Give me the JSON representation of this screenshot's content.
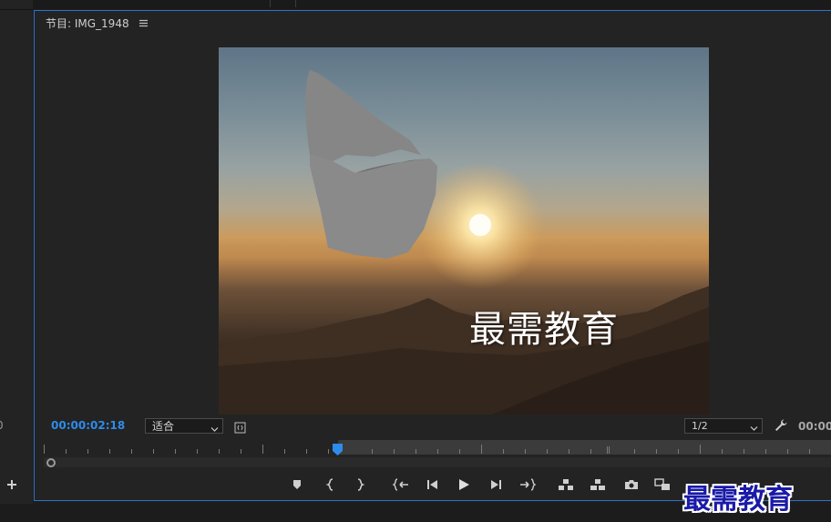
{
  "monitor": {
    "tab_label": "节目: IMG_1948",
    "menu_icon": "hamburger-icon"
  },
  "video": {
    "overlay_title": "最需教育"
  },
  "controls": {
    "timecode_current": "00:00:02:18",
    "fit_value": "适合",
    "resolution_value": "1/2",
    "timecode_right": "00:00",
    "wrench_icon": "wrench-icon"
  },
  "left_panel": {
    "edge_digit": "0",
    "add_icon": "plus-icon"
  },
  "transport": {
    "buttons": [
      {
        "name": "add-marker-button",
        "icon": "marker-icon"
      },
      {
        "name": "mark-in-button",
        "icon": "mark-in-icon"
      },
      {
        "name": "mark-out-button",
        "icon": "mark-out-icon"
      },
      {
        "name": "go-to-in-button",
        "icon": "go-to-in-icon"
      },
      {
        "name": "step-back-button",
        "icon": "step-back-icon"
      },
      {
        "name": "play-button",
        "icon": "play-icon"
      },
      {
        "name": "step-forward-button",
        "icon": "step-forward-icon"
      },
      {
        "name": "go-to-out-button",
        "icon": "go-to-out-icon"
      },
      {
        "name": "lift-button",
        "icon": "lift-icon"
      },
      {
        "name": "extract-button",
        "icon": "extract-icon"
      },
      {
        "name": "export-frame-button",
        "icon": "camera-icon"
      },
      {
        "name": "compare-view-button",
        "icon": "compare-icon"
      }
    ]
  },
  "watermark": {
    "text": "最需教育"
  },
  "colors": {
    "accent": "#2d8ceb",
    "panel_border": "#2e6fd0",
    "panel_bg": "#232323",
    "watermark": "#1a1aa8"
  }
}
